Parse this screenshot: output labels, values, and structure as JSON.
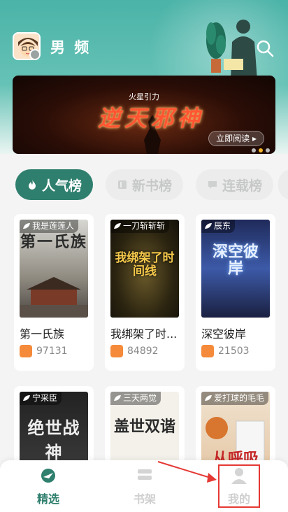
{
  "header": {
    "channel": "男 频",
    "icons": {
      "search": "search-icon",
      "avatar_badge": "switch-icon"
    }
  },
  "banner": {
    "brand": "火星引力",
    "title": "逆天邪神",
    "read_button": "立即阅读 ▸",
    "slides_total": 3,
    "slide_active": 2
  },
  "tabs": [
    {
      "label": "人气榜",
      "active": true,
      "icon": "fire-icon"
    },
    {
      "label": "新书榜",
      "active": false,
      "icon": "book-icon"
    },
    {
      "label": "连载榜",
      "active": false,
      "icon": "chat-icon"
    }
  ],
  "books": [
    {
      "author": "我是莲莲人",
      "title": "第一氏族",
      "cover_title": "第一氏族",
      "heat": "97131"
    },
    {
      "author": "一刀斩斩斩",
      "title": "我绑架了时...",
      "cover_title": "我绑架了时间线",
      "heat": "84892"
    },
    {
      "author": "辰东",
      "title": "深空彼岸",
      "cover_title": "深空彼岸",
      "heat": "21503"
    },
    {
      "author": "宁采臣",
      "title": "",
      "cover_title": "绝世战神",
      "heat": ""
    },
    {
      "author": "三天两觉",
      "title": "",
      "cover_title": "盖世双谐",
      "heat": ""
    },
    {
      "author": "爱打球的毛毛",
      "title": "",
      "cover_title": "从呼吸",
      "heat": ""
    }
  ],
  "bottom_nav": [
    {
      "label": "精选",
      "icon": "featured-icon",
      "active": true
    },
    {
      "label": "书架",
      "icon": "bookshelf-icon",
      "active": false
    },
    {
      "label": "我的",
      "icon": "profile-icon",
      "active": false
    }
  ],
  "colors": {
    "accent": "#2f7f6e",
    "highlight": "#e53935",
    "header_bg": "#4bb3a8"
  }
}
